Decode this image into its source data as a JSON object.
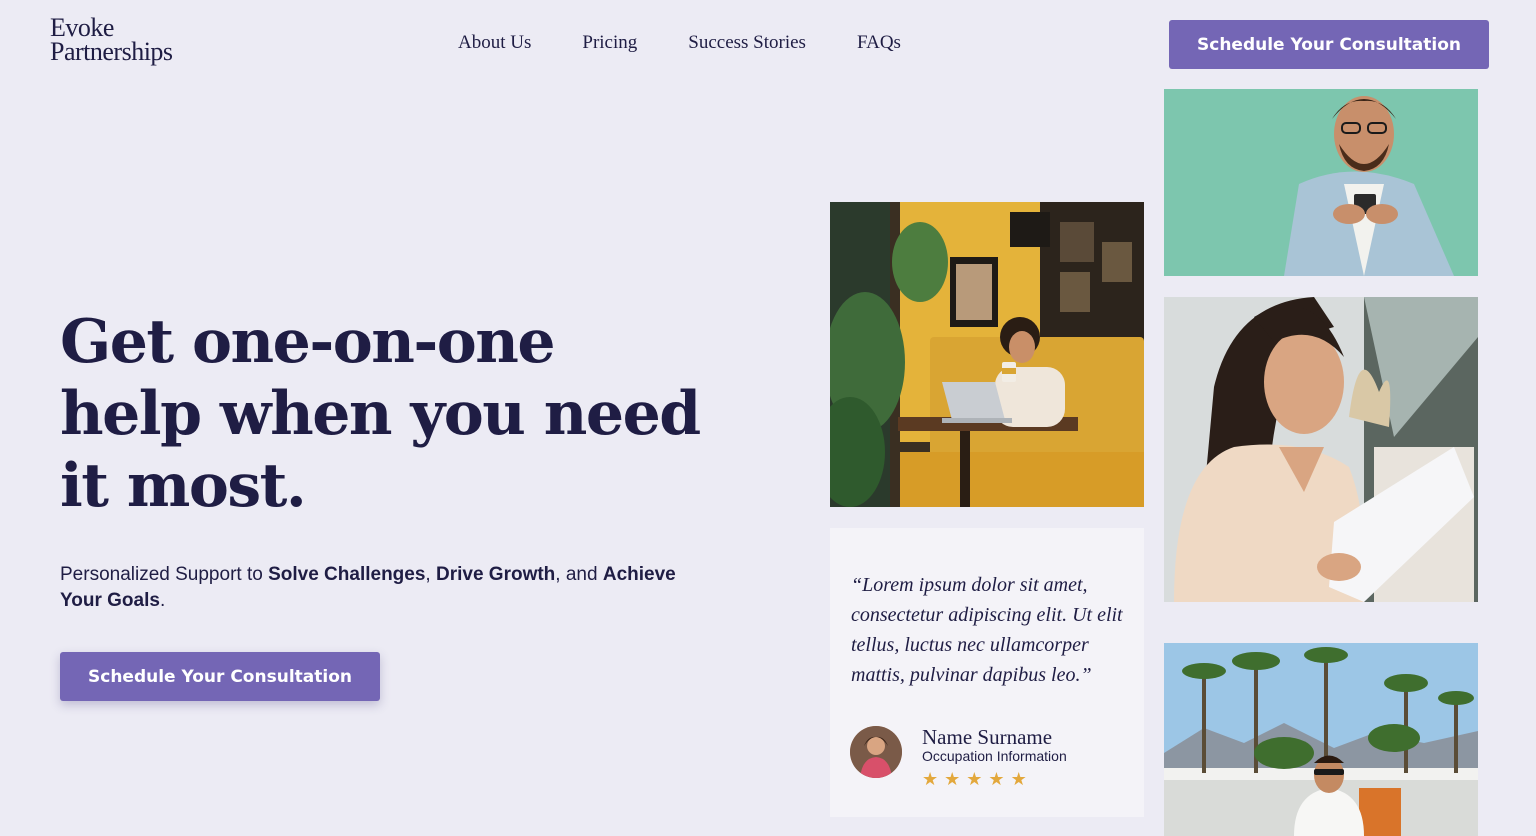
{
  "brand": {
    "line1": "Evoke",
    "line2": "Partnerships"
  },
  "nav": {
    "items": [
      {
        "label": "About Us"
      },
      {
        "label": "Pricing"
      },
      {
        "label": "Success Stories"
      },
      {
        "label": "FAQs"
      }
    ],
    "cta_label": "Schedule Your Consultation"
  },
  "hero": {
    "title_line1": "Get one-on-one",
    "title_line2": "help when you need",
    "title_line3": "it most.",
    "sub_prefix": "Personalized Support to ",
    "sub_b1": "Solve Challenges",
    "sub_sep1": ", ",
    "sub_b2": "Drive Growth",
    "sub_sep2": ", and ",
    "sub_b3": "Achieve Your Goals",
    "sub_suffix": ".",
    "cta_label": "Schedule Your Consultation"
  },
  "testimonial": {
    "quote": "“Lorem ipsum dolor sit amet, consectetur adipiscing elit. Ut elit tellus, luctus nec ullamcorper mattis, pulvinar dapibus leo.”",
    "name": "Name Surname",
    "occupation": "Occupation Information",
    "rating": 5,
    "stars": "★ ★ ★ ★ ★"
  },
  "icons": {
    "star": "star-icon"
  },
  "colors": {
    "background": "#ecebf4",
    "accent": "#7466b5",
    "text": "#1f1d44",
    "star": "#e3a83c"
  }
}
